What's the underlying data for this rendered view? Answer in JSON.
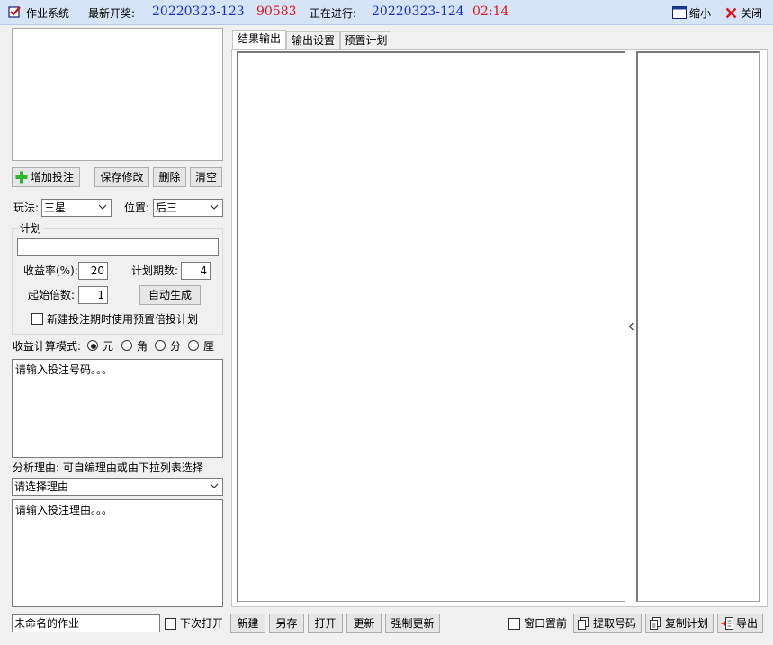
{
  "titlebar": {
    "app_title": "作业系统",
    "latest_label": "最新开奖:",
    "latest_period": "20220323-123",
    "latest_number": "90583",
    "current_label": "正在进行:",
    "current_period": "20220323-124",
    "countdown": "02:14",
    "minimize_label": "缩小",
    "close_label": "关闭"
  },
  "bet_controls": {
    "add_label": "增加投注",
    "save_label": "保存修改",
    "delete_label": "删除",
    "clear_label": "清空"
  },
  "play": {
    "mode_label": "玩法:",
    "mode_value": "三星",
    "position_label": "位置:",
    "position_value": "后三"
  },
  "plan": {
    "group_label": "计划",
    "plan_value": "",
    "yield_label": "收益率(%):",
    "yield_value": "20",
    "periods_label": "计划期数:",
    "periods_value": "4",
    "multiplier_label": "起始倍数:",
    "multiplier_value": "1",
    "auto_label": "自动生成",
    "use_preset_label": "新建投注期时使用预置倍投计划"
  },
  "profit_mode": {
    "label": "收益计算模式:",
    "options": [
      "元",
      "角",
      "分",
      "厘"
    ],
    "selected": "元"
  },
  "numbers_placeholder": "请输入投注号码。。。",
  "reason": {
    "label": "分析理由: 可自编理由或由下拉列表选择",
    "select_value": "请选择理由",
    "text_placeholder": "请输入投注理由。。。"
  },
  "tabs": [
    "结果输出",
    "输出设置",
    "预置计划"
  ],
  "active_tab": "结果输出",
  "bottom": {
    "job_name": "未命名的作业",
    "open_next_label": "下次打开",
    "new_label": "新建",
    "save_as_label": "另存",
    "open_label": "打开",
    "update_label": "更新",
    "force_update_label": "强制更新",
    "topmost_label": "窗口置前",
    "extract_label": "提取号码",
    "copy_plan_label": "复制计划",
    "export_label": "导出"
  },
  "colors": {
    "titlebar_bg": "#d6e4f7",
    "period_blue": "#1a2ecc",
    "number_red": "#e01515"
  }
}
